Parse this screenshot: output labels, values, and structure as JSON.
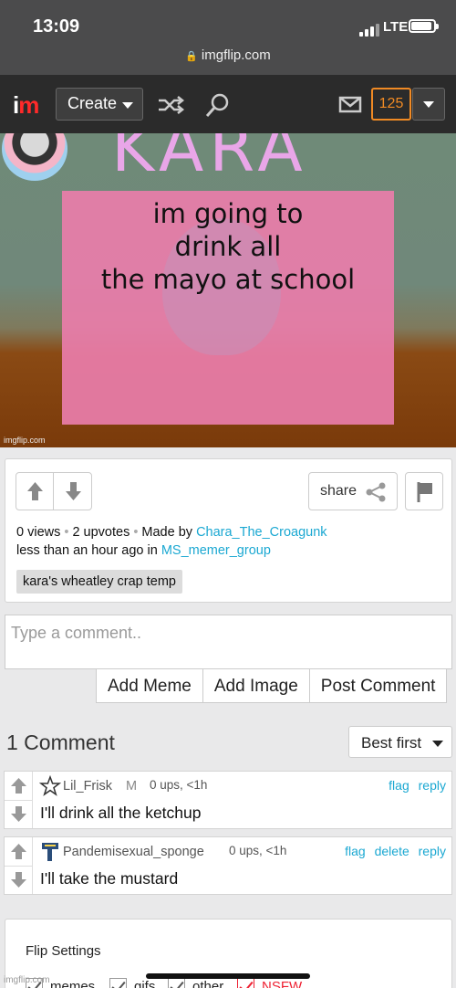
{
  "status": {
    "time": "13:09",
    "network": "LTE",
    "url": "imgflip.com"
  },
  "nav": {
    "logo_i": "i",
    "logo_m": "m",
    "create_label": "Create",
    "notifications_count": "125",
    "icons": [
      "shuffle-icon",
      "search-icon",
      "mail-icon",
      "chevron-down-icon"
    ]
  },
  "meme": {
    "header_text": "KARA",
    "caption_lines": [
      "im going to",
      "drink all",
      "the mayo at school"
    ],
    "watermark": "imgflip.com",
    "colors": {
      "panel": "#e97daa",
      "kara_text": "#e9a6e8"
    }
  },
  "post": {
    "share_label": "share",
    "views": "0 views",
    "upvotes": "2 upvotes",
    "made_by_label": "Made by",
    "author": "Chara_The_Croagunk",
    "time_prefix": "less than an hour ago in",
    "stream": "MS_memer_group",
    "template_tag": "kara's wheatley crap temp"
  },
  "comment_form": {
    "placeholder": "Type a comment..",
    "buttons": [
      "Add Meme",
      "Add Image",
      "Post Comment"
    ]
  },
  "comments_section": {
    "count_label": "1 Comment",
    "sort_label": "Best first",
    "items": [
      {
        "user": "Lil_Frisk",
        "user_tag": "M",
        "ups": "0 ups, <1h",
        "actions": [
          "flag",
          "reply"
        ],
        "text": "I'll drink all the ketchup"
      },
      {
        "user": "Pandemisexual_sponge",
        "user_tag": "",
        "ups": "0 ups, <1h",
        "actions": [
          "flag",
          "delete",
          "reply"
        ],
        "text": "I'll take the mustard"
      }
    ]
  },
  "flip_settings": {
    "title": "Flip Settings",
    "options": [
      "memes",
      "gifs",
      "other",
      "NSFW"
    ]
  },
  "accent_color": "#1ba8d2",
  "badge_color": "#f08a24"
}
